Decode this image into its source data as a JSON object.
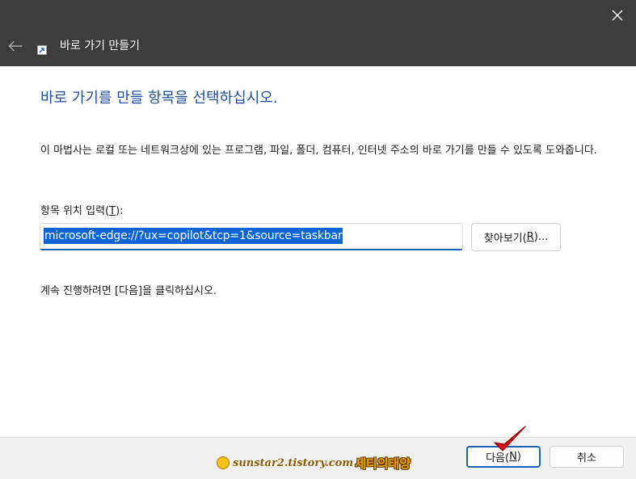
{
  "window": {
    "close_glyph": "✕",
    "back_icon": "arrow-left-icon",
    "wizard_title": "바로 가기 만들기"
  },
  "main": {
    "heading": "바로 가기를 만들 항목을 선택하십시오.",
    "description": "이 마법사는 로컬 또는 네트워크상에 있는 프로그램, 파일, 폴더, 컴퓨터, 인터넷 주소의 바로 가기를 만들 수 있도록 도와줍니다.",
    "field_label_prefix": "항목 위치 입력(",
    "field_label_key": "T",
    "field_label_suffix": "):",
    "location_value": "microsoft-edge://?ux=copilot&tcp=1&source=taskbar",
    "browse_prefix": "찾아보기(",
    "browse_key": "R",
    "browse_suffix": ")...",
    "continue_text": "계속 진행하려면 [다음]을 클릭하십시오."
  },
  "footer": {
    "next_prefix": "다음(",
    "next_key": "N",
    "next_suffix": ")",
    "cancel_label": "취소"
  },
  "watermark": {
    "site": "sunstar2.tistory.com",
    "name": "세티의태양"
  },
  "colors": {
    "titlebar": "#3c3c3c",
    "heading": "#1c4fa0",
    "accent": "#1c63b6",
    "selection": "#0a64d6",
    "check_mark": "#e01010"
  }
}
